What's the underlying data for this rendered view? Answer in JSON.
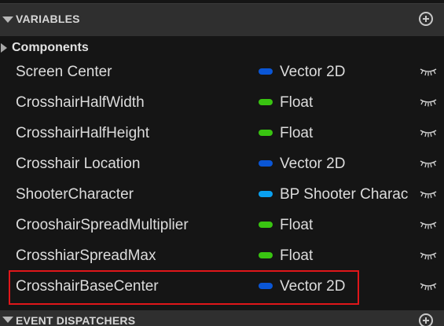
{
  "variables_section": {
    "title": "VARIABLES"
  },
  "category": {
    "label": "Components"
  },
  "variables": [
    {
      "name": "Screen Center",
      "type": "Vector 2D",
      "type_color": "#0a56d6"
    },
    {
      "name": "CrosshairHalfWidth",
      "type": "Float",
      "type_color": "#39c411"
    },
    {
      "name": "CrosshairHalfHeight",
      "type": "Float",
      "type_color": "#39c411"
    },
    {
      "name": "Crosshair Location",
      "type": "Vector 2D",
      "type_color": "#0a56d6"
    },
    {
      "name": "ShooterCharacter",
      "type": "BP Shooter Charac",
      "type_color": "#0aa0f0"
    },
    {
      "name": "CrooshairSpreadMultiplier",
      "type": "Float",
      "type_color": "#39c411"
    },
    {
      "name": "CrosshiarSpreadMax",
      "type": "Float",
      "type_color": "#39c411"
    },
    {
      "name": "CrosshairBaseCenter",
      "type": "Vector 2D",
      "type_color": "#0a56d6"
    }
  ],
  "event_dispatchers_section": {
    "title": "EVENT DISPATCHERS"
  },
  "highlight_color": "#e0161a"
}
